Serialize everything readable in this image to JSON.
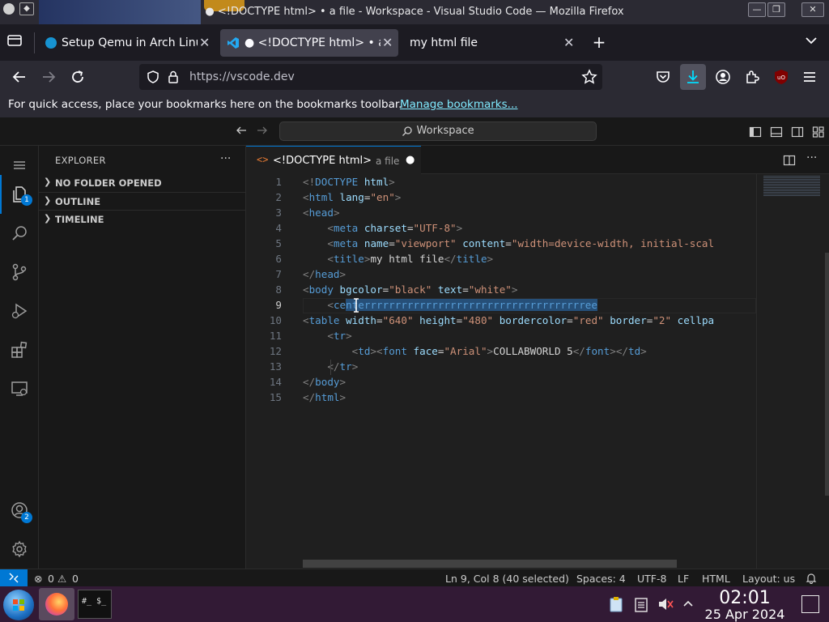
{
  "window": {
    "title": "● <!DOCTYPE html> • a file - Workspace - Visual Studio Code — Mozilla Firefox"
  },
  "browser": {
    "tabs": [
      {
        "label": "Setup Qemu in Arch Linu"
      },
      {
        "label": "● <!DOCTYPE html> • a"
      },
      {
        "label": "my html file"
      }
    ],
    "url": "https://vscode.dev",
    "bookmarks_message": "For quick access, place your bookmarks here on the bookmarks toolbar.",
    "bookmarks_link": "Manage bookmarks..."
  },
  "vscode": {
    "search_placeholder": "Workspace",
    "sidebar": {
      "title": "EXPLORER",
      "more": "···",
      "sections": [
        "NO FOLDER OPENED",
        "OUTLINE",
        "TIMELINE"
      ]
    },
    "activity_badges": {
      "explorer": "1",
      "accounts": "2"
    },
    "editor_tab": {
      "title": "<!DOCTYPE html>",
      "description": "a file",
      "dirty": "●"
    },
    "code_lines": [
      [
        [
          "gr",
          "<!"
        ],
        [
          "tg",
          "DOCTYPE"
        ],
        [
          "at",
          " html"
        ],
        [
          "gr",
          ">"
        ]
      ],
      [
        [
          "gr",
          "<"
        ],
        [
          "tg",
          "html"
        ],
        [
          "at",
          " lang"
        ],
        [
          "tx",
          "="
        ],
        [
          "st",
          "\"en\""
        ],
        [
          "gr",
          ">"
        ]
      ],
      [
        [
          "gr",
          "<"
        ],
        [
          "tg",
          "head"
        ],
        [
          "gr",
          ">"
        ]
      ],
      [
        [
          "tx",
          "    "
        ],
        [
          "gr",
          "<"
        ],
        [
          "tg",
          "meta"
        ],
        [
          "at",
          " charset"
        ],
        [
          "tx",
          "="
        ],
        [
          "st",
          "\"UTF-8\""
        ],
        [
          "gr",
          ">"
        ]
      ],
      [
        [
          "tx",
          "    "
        ],
        [
          "gr",
          "<"
        ],
        [
          "tg",
          "meta"
        ],
        [
          "at",
          " name"
        ],
        [
          "tx",
          "="
        ],
        [
          "st",
          "\"viewport\""
        ],
        [
          "at",
          " content"
        ],
        [
          "tx",
          "="
        ],
        [
          "st",
          "\"width=device-width, initial-scal"
        ]
      ],
      [
        [
          "tx",
          "    "
        ],
        [
          "gr",
          "<"
        ],
        [
          "tg",
          "title"
        ],
        [
          "gr",
          ">"
        ],
        [
          "tx",
          "my html file"
        ],
        [
          "gr",
          "</"
        ],
        [
          "tg",
          "title"
        ],
        [
          "gr",
          ">"
        ]
      ],
      [
        [
          "gr",
          "</"
        ],
        [
          "tg",
          "head"
        ],
        [
          "gr",
          ">"
        ]
      ],
      [
        [
          "gr",
          "<"
        ],
        [
          "tg",
          "body"
        ],
        [
          "at",
          " bgcolor"
        ],
        [
          "tx",
          "="
        ],
        [
          "st",
          "\"black\""
        ],
        [
          "at",
          " text"
        ],
        [
          "tx",
          "="
        ],
        [
          "st",
          "\"white\""
        ],
        [
          "gr",
          ">"
        ]
      ],
      [
        [
          "tx",
          "    "
        ],
        [
          "gr",
          "<"
        ],
        [
          "tg",
          "ce"
        ],
        [
          "tg sel",
          "nterrrrrrrrrrrrrrrrrrrrrrrrrrrrrrrrrrrree"
        ]
      ],
      [
        [
          "gr",
          "<"
        ],
        [
          "tg",
          "table"
        ],
        [
          "at",
          " width"
        ],
        [
          "tx",
          "="
        ],
        [
          "st",
          "\"640\""
        ],
        [
          "at",
          " height"
        ],
        [
          "tx",
          "="
        ],
        [
          "st",
          "\"480\""
        ],
        [
          "at",
          " bordercolor"
        ],
        [
          "tx",
          "="
        ],
        [
          "st",
          "\"red\""
        ],
        [
          "at",
          " border"
        ],
        [
          "tx",
          "="
        ],
        [
          "st",
          "\"2\""
        ],
        [
          "at",
          " cellpa"
        ]
      ],
      [
        [
          "tx",
          "    "
        ],
        [
          "gr",
          "<"
        ],
        [
          "tg",
          "tr"
        ],
        [
          "gr",
          ">"
        ]
      ],
      [
        [
          "tx",
          "        "
        ],
        [
          "gr",
          "<"
        ],
        [
          "tg",
          "td"
        ],
        [
          "gr",
          "><"
        ],
        [
          "tg",
          "font"
        ],
        [
          "at",
          " face"
        ],
        [
          "tx",
          "="
        ],
        [
          "st",
          "\"Arial\""
        ],
        [
          "gr",
          ">"
        ],
        [
          "tx",
          "COLLABWORLD 5"
        ],
        [
          "gr",
          "</"
        ],
        [
          "tg",
          "font"
        ],
        [
          "gr",
          "></"
        ],
        [
          "tg",
          "td"
        ],
        [
          "gr",
          ">"
        ]
      ],
      [
        [
          "tx",
          "    "
        ],
        [
          "gr",
          "</"
        ],
        [
          "tg",
          "tr"
        ],
        [
          "gr",
          ">"
        ]
      ],
      [
        [
          "gr",
          "</"
        ],
        [
          "tg",
          "body"
        ],
        [
          "gr",
          ">"
        ]
      ],
      [
        [
          "gr",
          "</"
        ],
        [
          "tg",
          "html"
        ],
        [
          "gr",
          ">"
        ]
      ]
    ],
    "line_numbers": [
      "1",
      "2",
      "3",
      "4",
      "5",
      "6",
      "7",
      "8",
      "9",
      "10",
      "11",
      "12",
      "13",
      "14",
      "15"
    ],
    "current_line": 9,
    "status": {
      "errors": "0",
      "warnings": "0",
      "position": "Ln 9, Col 8 (40 selected)",
      "spaces": "Spaces: 4",
      "encoding": "UTF-8",
      "eol": "LF",
      "language": "HTML",
      "layout": "Layout: us"
    }
  },
  "taskbar": {
    "time": "02:01",
    "date": "25 Apr 2024",
    "terminal_label": "#_ $_"
  },
  "colors": {
    "accent": "#0078d4",
    "firefox_link": "#80ebff",
    "taskbar": "#321a35"
  }
}
